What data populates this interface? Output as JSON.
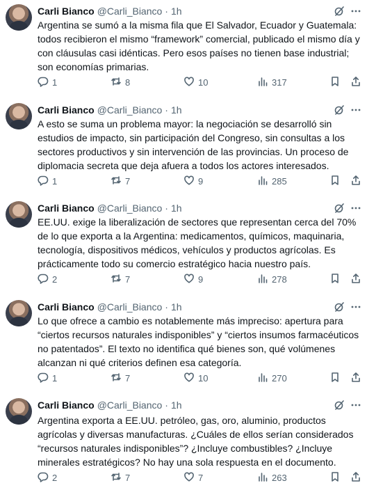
{
  "tweets": [
    {
      "author": "Carli Bianco",
      "handle": "@Carli_Bianco",
      "separator": "·",
      "time": "1h",
      "text": "Argentina se sumó a la misma fila que El Salvador, Ecuador y Guatemala: todos recibieron el mismo “framework” comercial, publicado el mismo día y con cláusulas casi idénticas. Pero esos países no tienen base industrial; son economías primarias.",
      "replies": "1",
      "retweets": "8",
      "likes": "10",
      "views": "317"
    },
    {
      "author": "Carli Bianco",
      "handle": "@Carli_Bianco",
      "separator": "·",
      "time": "1h",
      "text": "A esto se suma un problema mayor: la negociación se desarrolló sin estudios de impacto, sin participación del Congreso, sin consultas a los sectores productivos y sin intervención de las provincias. Un proceso de diplomacia secreta que deja afuera a todos los actores interesados.",
      "replies": "1",
      "retweets": "7",
      "likes": "9",
      "views": "285"
    },
    {
      "author": "Carli Bianco",
      "handle": "@Carli_Bianco",
      "separator": "·",
      "time": "1h",
      "text": "EE.UU. exige la liberalización de sectores que representan cerca del 70% de lo que exporta a la Argentina: medicamentos, químicos, maquinaria, tecnología, dispositivos médicos, vehículos y productos agrícolas. Es prácticamente todo su comercio estratégico hacia nuestro país.",
      "replies": "2",
      "retweets": "7",
      "likes": "9",
      "views": "278"
    },
    {
      "author": "Carli Bianco",
      "handle": "@Carli_Bianco",
      "separator": "·",
      "time": "1h",
      "text": "Lo que ofrece a cambio es notablemente más impreciso: apertura para “ciertos recursos naturales indisponibles” y “ciertos insumos farmacéuticos no patentados”. El texto no identifica qué bienes son, qué volúmenes alcanzan ni qué criterios definen esa categoría.",
      "replies": "1",
      "retweets": "7",
      "likes": "10",
      "views": "270"
    },
    {
      "author": "Carli Bianco",
      "handle": "@Carli_Bianco",
      "separator": "·",
      "time": "1h",
      "text": "Argentina exporta a EE.UU. petróleo, gas, oro, aluminio, productos agrícolas y diversas manufacturas. ¿Cuáles de ellos serían considerados “recursos naturales indisponibles”? ¿Incluye combustibles? ¿Incluye minerales estratégicos? No hay una sola respuesta en el documento.",
      "replies": "2",
      "retweets": "7",
      "likes": "7",
      "views": "263"
    }
  ],
  "icons": {
    "reply": "reply-icon",
    "retweet": "retweet-icon",
    "like": "heart-icon",
    "views": "views-icon",
    "bookmark": "bookmark-icon",
    "share": "share-icon",
    "grok": "grok-icon",
    "more": "more-icon"
  },
  "colors": {
    "text": "#0f1419",
    "secondary": "#536471",
    "background": "#ffffff"
  }
}
